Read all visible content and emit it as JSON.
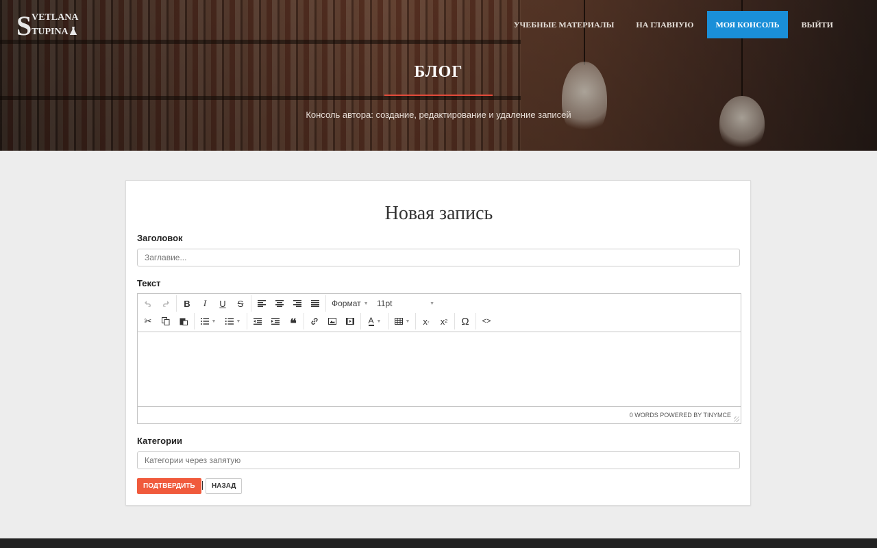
{
  "logo": {
    "initial": "S",
    "line1": "VETLANA",
    "line2": "TUPINA",
    "icon": "flask-icon"
  },
  "nav": {
    "items": [
      {
        "label": "УЧЕБНЫЕ МАТЕРИАЛЫ"
      },
      {
        "label": "НА ГЛАВНУЮ"
      },
      {
        "label": "МОЯ КОНСОЛЬ",
        "active": true
      },
      {
        "label": "ВЫЙТИ"
      }
    ],
    "active_color": "#1a8fd8"
  },
  "hero": {
    "title": "БЛОГ",
    "subtitle": "Консоль автора: создание, редактирование и удаление записей",
    "accent_color": "#e24a3a"
  },
  "form": {
    "heading": "Новая запись",
    "title_label": "Заголовок",
    "title_placeholder": "Заглавие...",
    "text_label": "Текст",
    "categories_label": "Категории",
    "categories_placeholder": "Категории через запятую",
    "submit_label": "ПОДТВЕРДИТЬ",
    "submit_color": "#f05a3c",
    "back_label": "НАЗАД"
  },
  "editor": {
    "format_label": "Формат",
    "size_label": "11pt",
    "status": "0 WORDS POWERED BY TINYMCE"
  }
}
